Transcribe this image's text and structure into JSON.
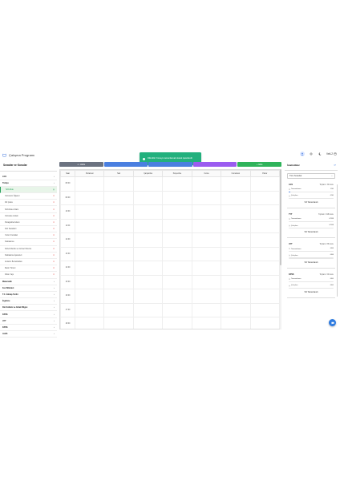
{
  "app": {
    "title": "Çalışma Programı",
    "user": "Veli-2"
  },
  "toast": {
    "message": "Dilimdiki: Konuyu tamamlamak olarak işaretlendi"
  },
  "sidebar": {
    "title": "Sınavlar ve Konular",
    "rows": [
      {
        "label": "LGS",
        "kind": "group",
        "mark": "chev"
      },
      {
        "label": "Türkçe",
        "kind": "group",
        "mark": "chev"
      },
      {
        "label": "Sözcükte",
        "kind": "sub",
        "mark": "check",
        "selected": true
      },
      {
        "label": "Cümlenin Öğeleri",
        "kind": "sub",
        "mark": "x"
      },
      {
        "label": "Fiil Çatısı",
        "kind": "sub",
        "mark": "x"
      },
      {
        "label": "Sözcükte Anlam",
        "kind": "sub",
        "mark": "x"
      },
      {
        "label": "Cümlede Anlam",
        "kind": "sub",
        "mark": "x"
      },
      {
        "label": "Paragrafta Anlam",
        "kind": "sub",
        "mark": "x"
      },
      {
        "label": "Söz Sanatları",
        "kind": "sub",
        "mark": "x"
      },
      {
        "label": "Yazım Kuralları",
        "kind": "sub",
        "mark": "x"
      },
      {
        "label": "Noktalama",
        "kind": "sub",
        "mark": "x"
      },
      {
        "label": "Sözel Mantık ve Görsel Okuma",
        "kind": "sub",
        "mark": "x"
      },
      {
        "label": "Noktalama İşaretleri",
        "kind": "sub",
        "mark": "x"
      },
      {
        "label": "Anlatım Bozuklukları",
        "kind": "sub",
        "mark": "x"
      },
      {
        "label": "Metin Türleri",
        "kind": "sub",
        "mark": "x"
      },
      {
        "label": "Fiilde Yapı",
        "kind": "sub",
        "mark": "x"
      },
      {
        "label": "Matematik",
        "kind": "group",
        "mark": "chev"
      },
      {
        "label": "Fen Bilimleri",
        "kind": "group",
        "mark": "chev"
      },
      {
        "label": "T.C. İnkılap Tarihi",
        "kind": "group",
        "mark": "chev"
      },
      {
        "label": "İngilizce",
        "kind": "group",
        "mark": "chev"
      },
      {
        "label": "Din Kültürü ve Ahlak Bilgisi",
        "kind": "group",
        "mark": "chev"
      },
      {
        "label": "KPSS",
        "kind": "group",
        "mark": "chev"
      },
      {
        "label": "AYT",
        "kind": "group",
        "mark": "chev"
      },
      {
        "label": "KPSS",
        "kind": "group",
        "mark": "chev"
      },
      {
        "label": "ALES",
        "kind": "group",
        "mark": "chev"
      }
    ]
  },
  "tabs": [
    {
      "label": "Hafta",
      "color": "#6b7280"
    },
    {
      "label": "",
      "color": "#4a7fe0"
    },
    {
      "label": "",
      "color": "#4a7fe0"
    },
    {
      "label": "",
      "color": "#9b5cf0"
    },
    {
      "label": "Ekle",
      "color": "#2fb35a"
    }
  ],
  "schedule": {
    "headers": [
      "Saat",
      "Pazartesi",
      "Salı",
      "Çarşamba",
      "Perşembe",
      "Cuma",
      "Cumartesi",
      "Pazar"
    ],
    "times": [
      "08:00",
      "09:00",
      "10:00",
      "11:00",
      "12:00",
      "13:00",
      "14:00",
      "15:00",
      "16:00",
      "17:00",
      "18:00"
    ]
  },
  "stats": {
    "title": "İstatistikler",
    "refresh_icon": "refresh-icon",
    "select_value": "Tüm Sınavlar",
    "cards": [
      {
        "name": "LGS",
        "target": "Toplam: 30 konu",
        "done_label": "Tamamlanan",
        "done_val": "1/30",
        "done_frac": 0.03,
        "work_label": "Çalışılan",
        "work_val": "0/30",
        "work_frac": 0.0,
        "pct": "%3 Tamamlandı"
      },
      {
        "name": "TYT",
        "target": "Toplam: 198 konu",
        "done_label": "Tamamlanan",
        "done_val": "0/198",
        "done_frac": 0.0,
        "work_label": "Çalışılan",
        "work_val": "0/198",
        "work_frac": 0.0,
        "pct": "%0 Tamamlandı"
      },
      {
        "name": "AYT",
        "target": "Toplam: 86 konu",
        "done_label": "Tamamlanan",
        "done_val": "0/86",
        "done_frac": 0.0,
        "work_label": "Çalışılan",
        "work_val": "0/86",
        "work_frac": 0.0,
        "pct": "%0 Tamamlandı"
      },
      {
        "name": "KPSS",
        "target": "Toplam: 60 konu",
        "done_label": "Tamamlanan",
        "done_val": "0/60",
        "done_frac": 0.0,
        "work_label": "Çalışılan",
        "work_val": "0/60",
        "work_frac": 0.0,
        "pct": "%0 Tamamlandı"
      }
    ]
  }
}
